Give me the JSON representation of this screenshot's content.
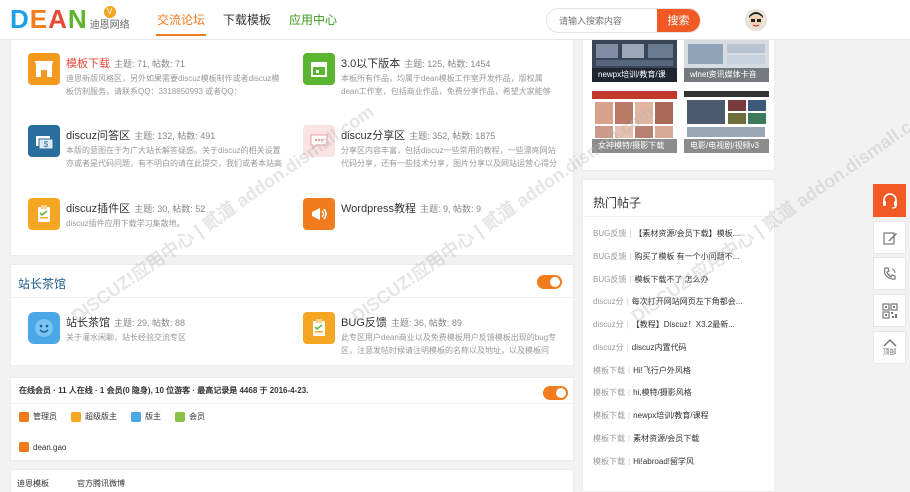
{
  "header": {
    "logo_letters": [
      "D",
      "E",
      "A",
      "N"
    ],
    "logo_badge": "V",
    "logo_sub": "迪恩网络",
    "nav": [
      {
        "label": "交流论坛",
        "state": "active"
      },
      {
        "label": "下载模板",
        "state": "normal"
      },
      {
        "label": "应用中心",
        "state": "green"
      }
    ],
    "search": {
      "placeholder": "请输入搜索内容",
      "button": "搜索"
    }
  },
  "forums_top": [
    {
      "name": "模板下载",
      "stats": "主题: 71, 帖数: 71",
      "desc": "迪恩新版风格区，另外如果需要discuz模板制作或者discuz模板仿制服务，请联系QQ：3318850993 或者QQ：",
      "icon": "shop-icon",
      "color": "#f39a1e",
      "red": true
    },
    {
      "name": "3.0以下版本",
      "stats": "主题: 125, 帖数: 1454",
      "desc": "本板所有作品，均属于dean模板工作室开发作品，版权属dean工作室，包括商业作品，免费分享作品，希望大家能够找到喜",
      "icon": "calendar-icon",
      "color": "#5cb531",
      "red": false
    },
    {
      "name": "discuz问答区",
      "stats": "主题: 132, 帖数: 491",
      "desc": "本版的意图在于为广大站长解答疑惑。关于discuz的相关设置亦或者是代码问题，有不明白的请在此提交，我们或者本站高",
      "icon": "money-icon",
      "color": "#2a6e9e",
      "red": false
    },
    {
      "name": "discuz分享区",
      "stats": "主题: 352, 帖数: 1875",
      "desc": "分享区内容丰富，包括discuz一些常用的教程，一些漂亮网站代码分享，还有一些技术分享，图片分享以及网站运营心得分",
      "icon": "chat-icon",
      "color": "#f5c6c6",
      "red": false
    },
    {
      "name": "discuz插件区",
      "stats": "主题: 30, 帖数: 52",
      "desc": "discuz插件应用下载学习集散地。",
      "icon": "clipboard-icon",
      "color": "#f5a623",
      "red": false
    },
    {
      "name": "Wordpress教程",
      "stats": "主题: 9, 帖数: 9",
      "desc": "",
      "icon": "megaphone-icon",
      "color": "#f07c1e",
      "red": false
    }
  ],
  "teahouse": {
    "title": "站长茶馆",
    "forums": [
      {
        "name": "站长茶馆",
        "stats": "主题: 29, 帖数: 88",
        "desc": "关于灌水闲聊，站长经验交流专区",
        "icon": "smile-icon",
        "color": "#4aa8e8"
      },
      {
        "name": "BUG反馈",
        "stats": "主题: 36, 帖数: 89",
        "desc": "此专区用户dean商业以及免费模板用户反馈模板出现的bug专区，注意发帖时候请注明模板的名称以及地址，以及模板问",
        "icon": "clipboard-icon",
        "color": "#f5a623"
      }
    ]
  },
  "online": {
    "title": "在线会员 · 11 人在线 · 1 会员(0 隐身), 10 位游客 · 最高记录是 4468 于 2016-4-23.",
    "legend": [
      {
        "label": "管理员",
        "color": "#f07c1e"
      },
      {
        "label": "超级版主",
        "color": "#f5a623"
      },
      {
        "label": "版主",
        "color": "#4aa8e8"
      },
      {
        "label": "会员",
        "color": "#8bc34a"
      }
    ],
    "member": "dean.gao"
  },
  "links": [
    "迪恩模板",
    "官方腾讯微博"
  ],
  "thumbs": [
    {
      "caption": "newpx培训/教育/课"
    },
    {
      "caption": "wlnet资讯媒体卡音"
    },
    {
      "caption": "女神模特/摄影下载"
    },
    {
      "caption": "电影/电视剧/视频v3"
    }
  ],
  "hot": {
    "title": "热门帖子",
    "items": [
      {
        "cat": "BUG反馈",
        "text": "【素材资源/会员下载】模板..."
      },
      {
        "cat": "BUG反馈",
        "text": "购买了模板 有一个小问题不..."
      },
      {
        "cat": "BUG反馈",
        "text": "模板下载不了 怎么办"
      },
      {
        "cat": "discuz分",
        "text": "每次打开网站网页左下角都会..."
      },
      {
        "cat": "discuz分",
        "text": "【教程】Discuz！X3.2最新..."
      },
      {
        "cat": "discuz分",
        "text": "discuz内置代码"
      },
      {
        "cat": "模板下载",
        "text": "Hi!飞行户外风格"
      },
      {
        "cat": "模板下载",
        "text": "hi,模特/摄影风格"
      },
      {
        "cat": "模板下载",
        "text": "newpx培训/教育/课程"
      },
      {
        "cat": "模板下载",
        "text": "素材资源/会员下载"
      },
      {
        "cat": "模板下载",
        "text": "Hi!abroad!留学风"
      }
    ]
  },
  "sidetools": [
    {
      "icon": "headset-icon"
    },
    {
      "icon": "edit-icon"
    },
    {
      "icon": "phone-icon"
    },
    {
      "icon": "qrcode-icon"
    },
    {
      "icon": "back-to-top-icon",
      "label": "顶部"
    }
  ],
  "watermark": "DISCUZ!应用中心 | 贰道 addon.dismall.com"
}
